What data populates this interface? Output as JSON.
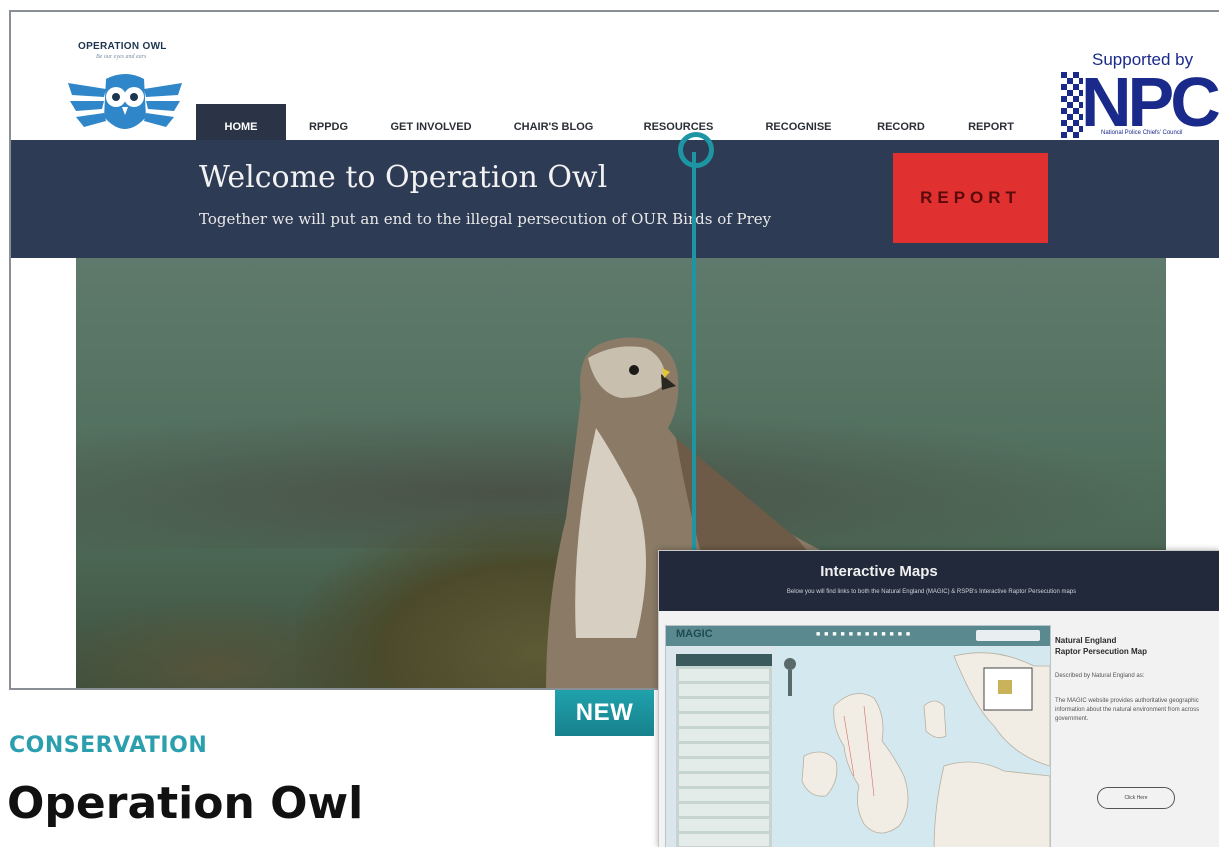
{
  "site": {
    "logo_title": "OPERATION OWL",
    "logo_tagline": "Be our eyes and ears",
    "supporter_label": "Supported by",
    "supporter_name": "NPCC",
    "supporter_subtitle": "National Police Chiefs' Council"
  },
  "nav": {
    "items": [
      {
        "label": "HOME",
        "active": true
      },
      {
        "label": "RPPDG",
        "active": false
      },
      {
        "label": "GET INVOLVED",
        "active": false
      },
      {
        "label": "CHAIR'S BLOG",
        "active": false
      },
      {
        "label": "RESOURCES",
        "active": false
      },
      {
        "label": "RECOGNISE",
        "active": false
      },
      {
        "label": "RECORD",
        "active": false
      },
      {
        "label": "REPORT",
        "active": false
      }
    ]
  },
  "banner": {
    "title": "Welcome to Operation Owl",
    "subtitle": "Together we will put an end to the illegal persecution of OUR Birds of Prey",
    "report_button": "REPORT",
    "background_color": "#2e3b55",
    "report_color": "#e03030"
  },
  "inset": {
    "title": "Interactive Maps",
    "description": "Below you will find links to both the Natural England (MAGIC) & RSPB's Interactive Raptor Persecution maps",
    "map_logo": "MAGIC",
    "panel_title_line1": "Natural England",
    "panel_title_line2": "Raptor Persecution Map",
    "panel_credit": "Described by Natural England as:",
    "panel_text": "The MAGIC website provides authoritative geographic information about the natural environment from across government.",
    "panel_button": "Click Here"
  },
  "badge": {
    "label": "NEW",
    "color": "#1e95a3"
  },
  "caption": {
    "category": "CONSERVATION",
    "headline": "Operation Owl"
  },
  "icons": {
    "owl_logo": "owl-logo-icon",
    "npcc_mark": "npcc-checkered-icon"
  }
}
